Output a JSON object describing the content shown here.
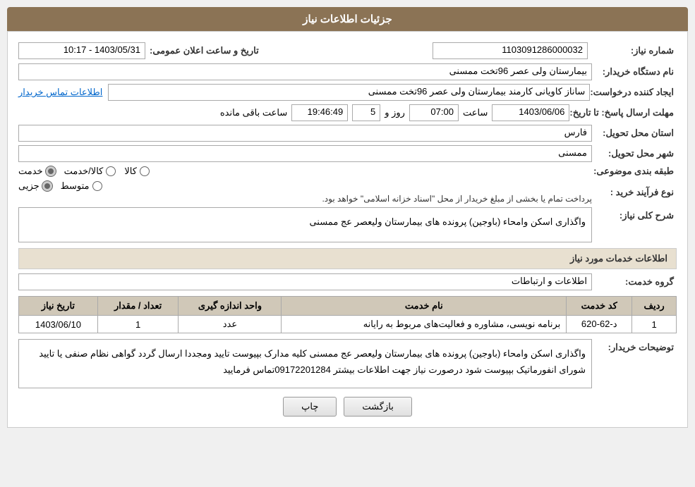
{
  "page": {
    "title": "جزئیات اطلاعات نیاز",
    "sections": {
      "header": "جزئیات اطلاعات نیاز",
      "services_header": "اطلاعات خدمات مورد نیاز"
    },
    "fields": {
      "shomara_niaz_label": "شماره نیاز:",
      "shomara_niaz_value": "1103091286000032",
      "nam_dastgah_label": "نام دستگاه خریدار:",
      "nam_dastgah_value": "بیمارستان ولی عصر  96تخت ممسنی",
      "ijad_konande_label": "ایجاد کننده درخواست:",
      "ijad_konande_value": "ساناز کاویانی کارمند بیمارستان ولی عصر  96تخت ممسنی",
      "ettelaat_tamas_label": "اطلاعات تماس خریدار",
      "mohlat_label": "مهلت ارسال پاسخ: تا تاریخ:",
      "tarikh_value": "1403/06/06",
      "saat_label": "ساعت",
      "saat_value": "07:00",
      "roz_label": "روز و",
      "roz_value": "5",
      "mande_label": "ساعت باقی مانده",
      "mande_value": "19:46:49",
      "ostan_label": "استان محل تحویل:",
      "ostan_value": "فارس",
      "shahr_label": "شهر محل تحویل:",
      "shahr_value": "ممسنی",
      "tabaqe_label": "طبقه بندی موضوعی:",
      "radio_khidmat": "خدمت",
      "radio_kala_khidmat": "کالا/خدمت",
      "radio_kala": "کالا",
      "noe_faraind_label": "نوع فرآیند خرید :",
      "radio_jozi": "جزیی",
      "radio_motovaset": "متوسط",
      "payment_note": "پرداخت تمام یا بخشی از مبلغ خریدار از محل \"اسناد خزانه اسلامی\" خواهد بود.",
      "sharh_label": "شرح کلی نیاز:",
      "sharh_value": "واگذاری اسکن وامحاء (باوجین) پرونده های بیمارستان ولیعصر عج ممسنی",
      "group_khadmat_label": "گروه خدمت:",
      "group_khadmat_value": "اطلاعات و ارتباطات",
      "tarikh_elaan_label": "تاریخ و ساعت اعلان عمومی:",
      "tarikh_elaan_value": "1403/05/31 - 10:17"
    },
    "service_table": {
      "headers": [
        "ردیف",
        "کد خدمت",
        "نام خدمت",
        "واحد اندازه گیری",
        "تعداد / مقدار",
        "تاریخ نیاز"
      ],
      "rows": [
        {
          "radif": "1",
          "kod": "د-62-620",
          "name": "برنامه نویسی، مشاوره و فعالیت‌های مربوط به رایانه",
          "vahed": "عدد",
          "tedad": "1",
          "tarikh": "1403/06/10"
        }
      ]
    },
    "tosihaat_label": "توضیحات خریدار:",
    "tosihaat_value": "واگذاری اسکن وامحاء (باوجین) پرونده های بیمارستان ولیعصر عج ممسنی کلیه مدارک بپیوست تایید ومجددا ارسال گردد گواهی نظام صنفی یا تایید شورای انفورماتیک بپیوست شود درصورت نیاز جهت اطلاعات بیشتر 09172201284تماس فرمایید",
    "buttons": {
      "chap": "چاپ",
      "bazgasht": "بازگشت"
    }
  }
}
